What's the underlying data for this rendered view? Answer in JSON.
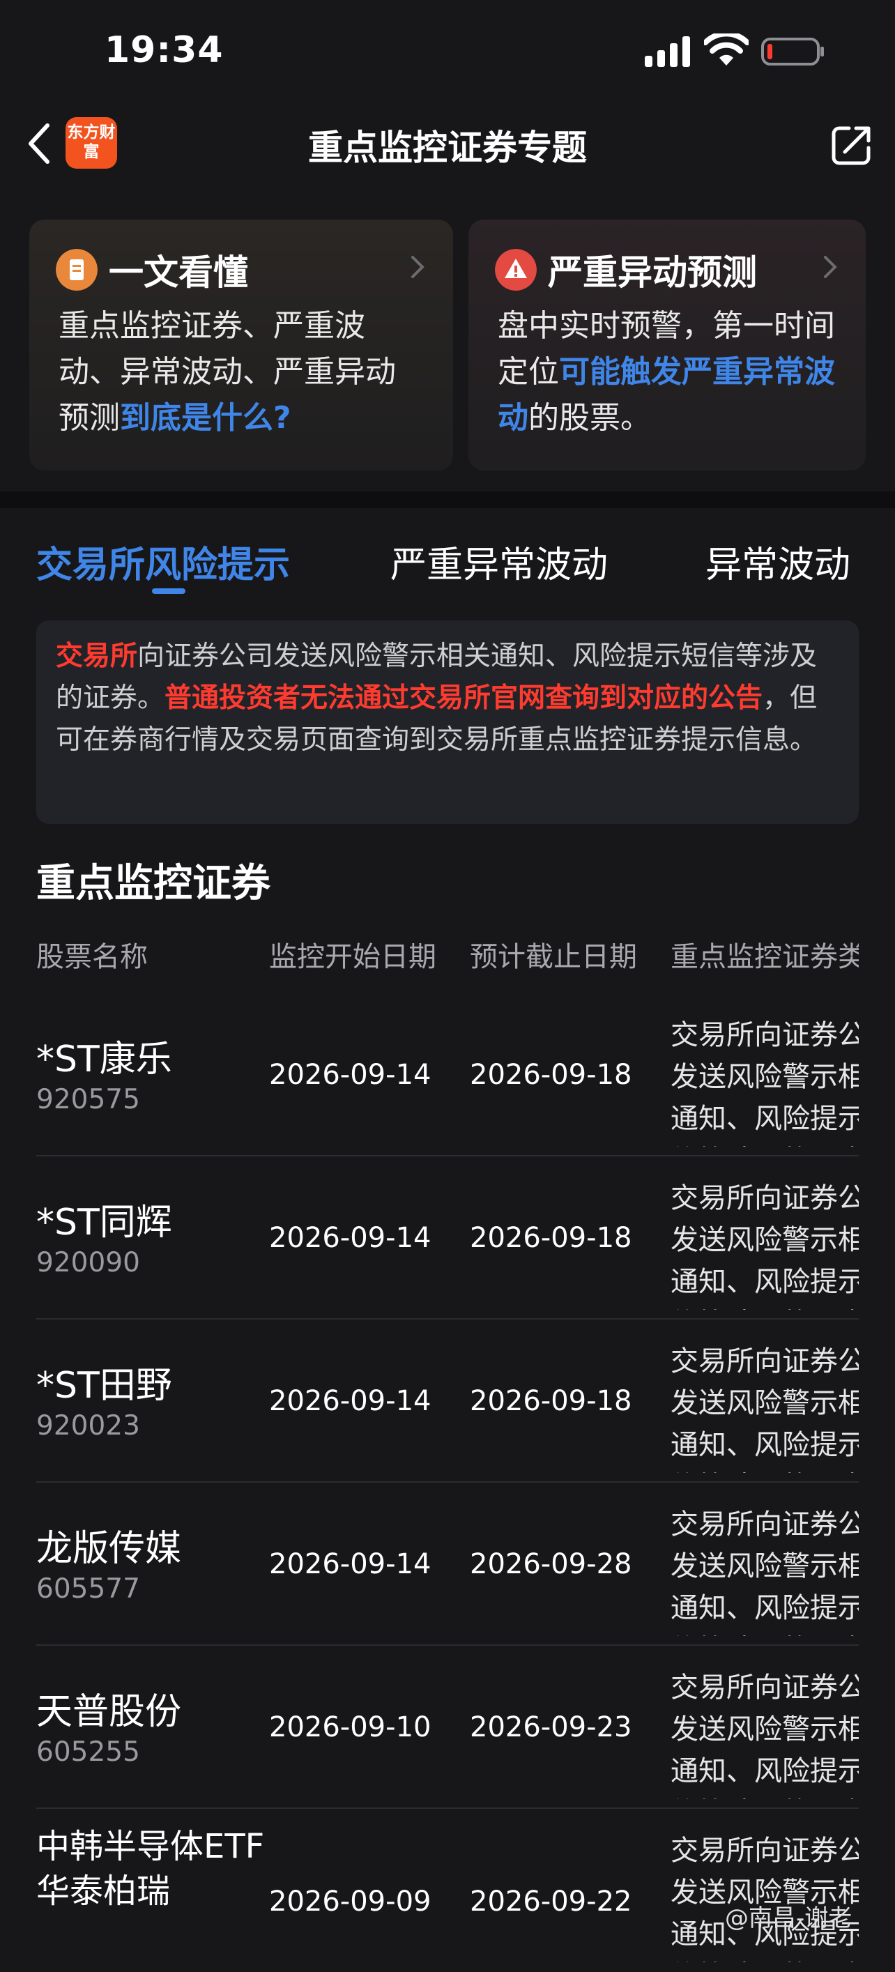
{
  "status": {
    "time": "19:34"
  },
  "nav": {
    "logo_text": "东方财富",
    "title": "重点监控证券专题"
  },
  "cards": [
    {
      "title": "一文看懂",
      "text_before": "重点监控证券、严重波动、异常波动、严重异动预测",
      "text_link": "到底是什么?",
      "text_after": ""
    },
    {
      "title": "严重异动预测",
      "text_before": "盘中实时预警，第一时间定位",
      "text_link": "可能触发严重异常波动",
      "text_after": "的股票。"
    }
  ],
  "tabs": [
    "交易所风险提示",
    "严重异常波动",
    "异常波动"
  ],
  "notice": {
    "p1": "交易所",
    "p2": "向证券公司发送风险警示相关通知、风险提示短信等涉及的证券。",
    "p3": "普通投资者无法通过交易所官网查询到对应的公告",
    "p4": "，但可在券商行情及交易页面查询到交易所重点监控证券提示信息。"
  },
  "section_title": "重点监控证券",
  "columns": [
    "股票名称",
    "监控开始日期",
    "预计截止日期",
    "重点监控证券类"
  ],
  "rows": [
    {
      "name": "*ST康乐",
      "code": "920575",
      "start": "2026-09-14",
      "end": "2026-09-18",
      "type": "交易所向证券公司发送风险警示相关通知、风险提示短信等涉及的证券"
    },
    {
      "name": "*ST同辉",
      "code": "920090",
      "start": "2026-09-14",
      "end": "2026-09-18",
      "type": "交易所向证券公司发送风险警示相关通知、风险提示短信等涉及的证券"
    },
    {
      "name": "*ST田野",
      "code": "920023",
      "start": "2026-09-14",
      "end": "2026-09-18",
      "type": "交易所向证券公司发送风险警示相关通知、风险提示短信等涉及的证券"
    },
    {
      "name": "龙版传媒",
      "code": "605577",
      "start": "2026-09-14",
      "end": "2026-09-28",
      "type": "交易所向证券公司发送风险警示相关通知、风险提示短信等涉及的证券"
    },
    {
      "name": "天普股份",
      "code": "605255",
      "start": "2026-09-10",
      "end": "2026-09-23",
      "type": "交易所向证券公司发送风险警示相关通知、风险提示短信等涉及的证券"
    },
    {
      "name": "中韩半导体ETF华泰柏瑞",
      "code": "",
      "start": "2026-09-09",
      "end": "2026-09-22",
      "type": "交易所向证券公司发送风险警示相关通知、风险提示短信等涉及的证券"
    }
  ],
  "watermark": "@南昌-谢老",
  "colors": {
    "accent": "#3f86e8",
    "warning": "#ff3b30",
    "logo": "#f2531f",
    "card1_icon": "#e9873a",
    "card2_icon": "#e24a42"
  }
}
